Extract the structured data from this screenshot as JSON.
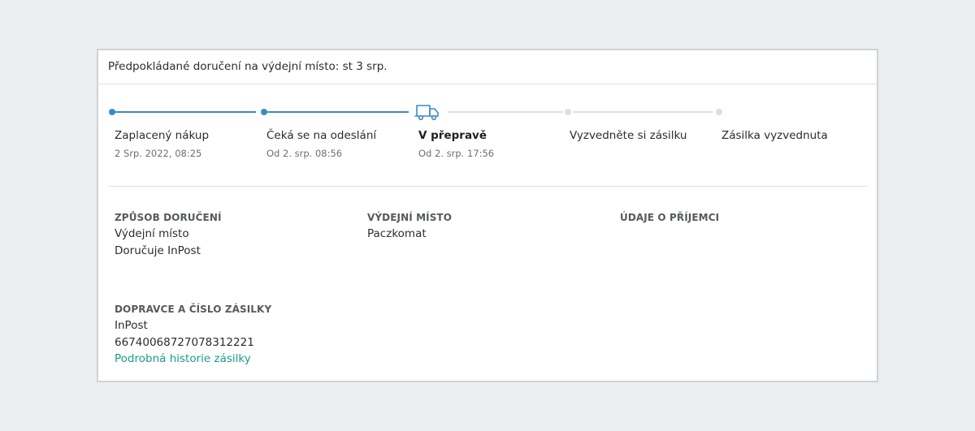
{
  "header": {
    "delivery_estimate": "Předpokládané doručení na výdejní místo: st 3 srp."
  },
  "progress": {
    "steps": [
      {
        "title": "Zaplacený nákup",
        "date": "2 Srp. 2022, 08:25",
        "state": "done"
      },
      {
        "title": "Čeká se na odeslání",
        "date": "Od 2. srp. 08:56",
        "state": "done"
      },
      {
        "title": "V přepravě",
        "date": "Od 2. srp. 17:56",
        "state": "active"
      },
      {
        "title": "Vyzvedněte si zásilku",
        "date": "",
        "state": "todo"
      },
      {
        "title": "Zásilka vyzvednuta",
        "date": "",
        "state": "todo"
      }
    ],
    "active_icon": "truck-icon"
  },
  "shipping_method": {
    "title": "ZPŮSOB DORUČENÍ",
    "lines": [
      "Výdejní místo",
      "Doručuje InPost"
    ]
  },
  "pickup_point": {
    "title": "VÝDEJNÍ MÍSTO",
    "lines": [
      "Paczkomat"
    ]
  },
  "recipient": {
    "title": "ÚDAJE O PŘÍJEMCI"
  },
  "carrier": {
    "title": "DOPRAVCE A ČÍSLO ZÁSILKY",
    "name": "InPost",
    "tracking_number": "66740068727078312221",
    "history_link": "Podrobná historie zásilky"
  },
  "colors": {
    "accent": "#3a8bc6",
    "link": "#1a9e8a",
    "inactive": "#dcdfe3",
    "background": "#ebeef1"
  }
}
